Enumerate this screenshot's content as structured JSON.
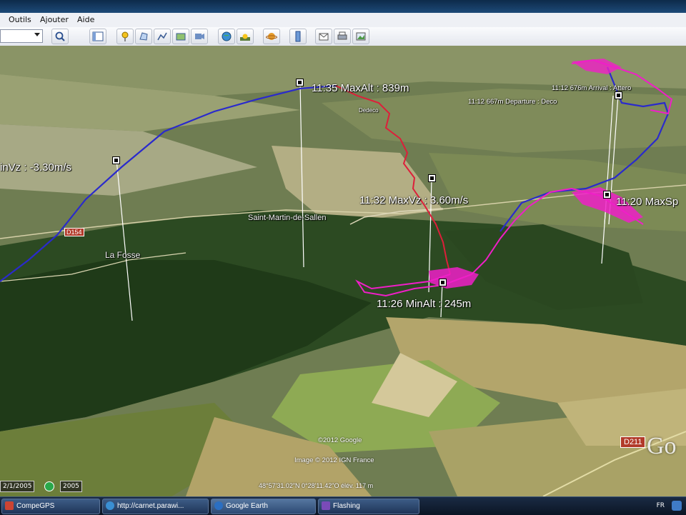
{
  "menu": {
    "items": [
      "Outils",
      "Ajouter",
      "Aide"
    ]
  },
  "toolbar": {
    "buttons": [
      "search-icon",
      "sidebar-icon",
      "placemark-icon",
      "polygon-icon",
      "path-icon",
      "overlay-icon",
      "tour-icon",
      "globe-icon",
      "sunlight-icon",
      "planet-icon",
      "ruler-icon",
      "email-icon",
      "print-icon",
      "image-icon"
    ]
  },
  "map": {
    "labels": {
      "min_vz": "inVz : -3.30m/s",
      "max_alt": "11:35 MaxAlt : 839m",
      "max_vz": "11:32 MaxVz : 3.60m/s",
      "min_alt": "11:26 MinAlt : 245m",
      "max_speed": "11:20 MaxSp",
      "arrival": "11:12 676m  Arrival : Attero",
      "departure": "11:12 667m  Departure : Deco",
      "top_small": "Dedeco"
    },
    "places": {
      "saint_martin": "Saint-Martin-de-Sallen",
      "la_fosse": "La Fosse"
    },
    "roads": {
      "d154": "D154",
      "d211": "D211"
    },
    "credits": {
      "google": "©2012 Google",
      "image": "Image © 2012 IGN France"
    },
    "logo": "Go"
  },
  "status": {
    "date_left": "2/1/2005",
    "date_right": "2005",
    "coords": "48°57'31.02\"N   0°28'11.42\"O  élév.  117 m"
  },
  "taskbar": {
    "items": [
      "CompeGPS",
      "http://carnet.parawi...",
      "Google Earth",
      "Flashing"
    ],
    "tray": "FR"
  },
  "colors": {
    "track_blue": "#2a2acc",
    "track_red": "#dd1f3a",
    "track_magenta": "#f01ec8"
  }
}
